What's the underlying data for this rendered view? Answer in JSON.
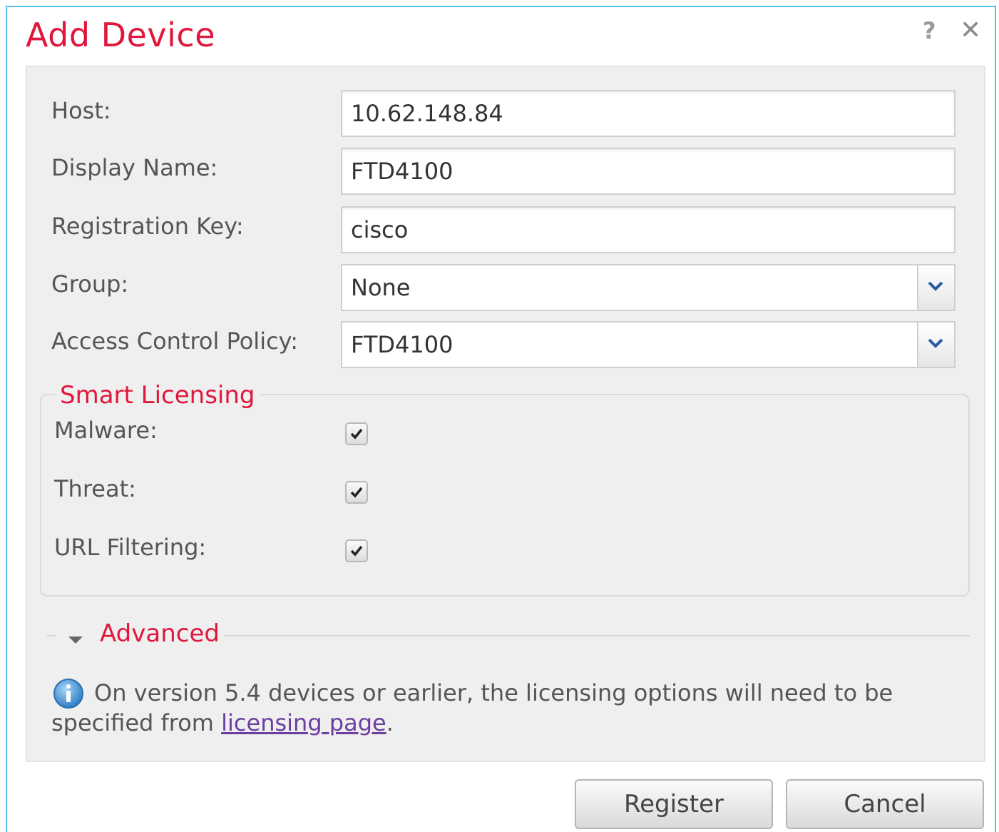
{
  "dialog": {
    "title": "Add Device",
    "help_glyph": "?",
    "close_glyph": "✕"
  },
  "form": {
    "host": {
      "label": "Host:",
      "value": "10.62.148.84"
    },
    "display_name": {
      "label": "Display Name:",
      "value": "FTD4100"
    },
    "registration_key": {
      "label": "Registration Key:",
      "value": "cisco"
    },
    "group": {
      "label": "Group:",
      "value": "None"
    },
    "access_control_policy": {
      "label": "Access Control Policy:",
      "value": "FTD4100"
    }
  },
  "smart_licensing": {
    "legend": "Smart Licensing",
    "items": [
      {
        "label": "Malware:",
        "checked": true
      },
      {
        "label": "Threat:",
        "checked": true
      },
      {
        "label": "URL Filtering:",
        "checked": true
      }
    ]
  },
  "advanced": {
    "label": "Advanced"
  },
  "info": {
    "text_before": "On version 5.4 devices or earlier, the licensing options will need to be specified from ",
    "link_text": "licensing page",
    "text_after": "."
  },
  "buttons": {
    "register": "Register",
    "cancel": "Cancel"
  },
  "colors": {
    "accent": "#e0173c",
    "border": "#5bc4ec",
    "panel": "#efefef",
    "link": "#6b3fa0"
  }
}
